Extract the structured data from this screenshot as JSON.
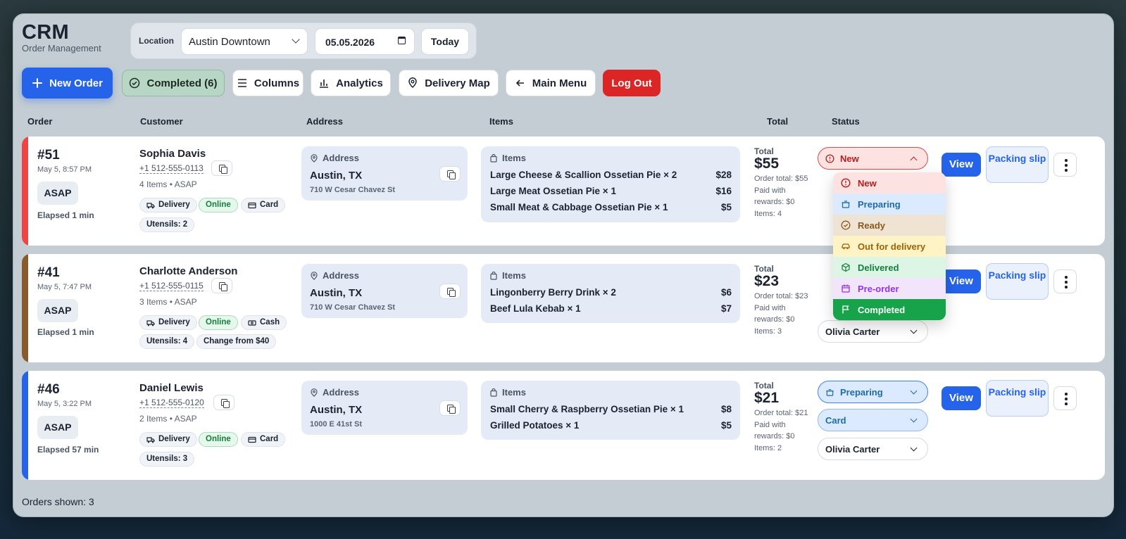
{
  "brand": {
    "title": "CRM",
    "subtitle": "Order Management"
  },
  "filters": {
    "location_label": "Location",
    "location_value": "Austin Downtown",
    "date_value": "05.05.2026",
    "today_label": "Today"
  },
  "toolbar": {
    "new_order": "New Order",
    "completed": "Completed (6)",
    "columns": "Columns",
    "analytics": "Analytics",
    "delivery_map": "Delivery Map",
    "main_menu": "Main Menu",
    "logout": "Log Out"
  },
  "columns": {
    "order": "Order",
    "customer": "Customer",
    "address": "Address",
    "items": "Items",
    "total": "Total",
    "status": "Status"
  },
  "orders": [
    {
      "number": "#51",
      "date": "May 5, 8:57 PM",
      "asap": "ASAP",
      "elapsed": "Elapsed 1 min",
      "customer": "Sophia Davis",
      "phone": "+1 512-555-0113",
      "items_count": "4 Items",
      "timing": "ASAP",
      "chips": [
        "Delivery",
        "Online",
        "Card",
        "Utensils: 2"
      ],
      "address_label": "Address",
      "city": "Austin, TX",
      "street": "710 W Cesar Chavez St",
      "items_label": "Items",
      "items": [
        {
          "name": "Large Cheese & Scallion Ossetian Pie × 2",
          "price": "$28"
        },
        {
          "name": "Large Meat Ossetian Pie × 1",
          "price": "$16"
        },
        {
          "name": "Small Meat & Cabbage Ossetian Pie × 1",
          "price": "$5"
        }
      ],
      "total_label": "Total",
      "total": "$55",
      "order_total": "Order total: $55",
      "paid_rewards": "Paid with rewards: $0",
      "items_summary": "Items: 4",
      "status": "New",
      "accent": "#ef4444"
    },
    {
      "number": "#41",
      "date": "May 5, 7:47 PM",
      "asap": "ASAP",
      "elapsed": "Elapsed 1 min",
      "customer": "Charlotte Anderson",
      "phone": "+1 512-555-0115",
      "items_count": "3 Items",
      "timing": "ASAP",
      "chips": [
        "Delivery",
        "Online",
        "Cash",
        "Utensils: 4",
        "Change from $40"
      ],
      "address_label": "Address",
      "city": "Austin, TX",
      "street": "710 W Cesar Chavez St",
      "items_label": "Items",
      "items": [
        {
          "name": "Lingonberry Berry Drink × 2",
          "price": "$6"
        },
        {
          "name": "Beef Lula Kebab × 1",
          "price": "$7"
        }
      ],
      "total_label": "Total",
      "total": "$23",
      "order_total": "Order total: $23",
      "paid_rewards": "Paid with rewards: $0",
      "items_summary": "Items: 3",
      "courier": "Olivia Carter",
      "accent": "#8b5a2b"
    },
    {
      "number": "#46",
      "date": "May 5, 3:22 PM",
      "asap": "ASAP",
      "elapsed": "Elapsed 57 min",
      "customer": "Daniel Lewis",
      "phone": "+1 512-555-0120",
      "items_count": "2 Items",
      "timing": "ASAP",
      "chips": [
        "Delivery",
        "Online",
        "Card",
        "Utensils: 3"
      ],
      "address_label": "Address",
      "city": "Austin, TX",
      "street": "1000 E 41st St",
      "items_label": "Items",
      "items": [
        {
          "name": "Small Cherry & Raspberry Ossetian Pie × 1",
          "price": "$8"
        },
        {
          "name": "Grilled Potatoes × 1",
          "price": "$5"
        }
      ],
      "total_label": "Total",
      "total": "$21",
      "order_total": "Order total: $21",
      "paid_rewards": "Paid with rewards: $0",
      "items_summary": "Items: 2",
      "status": "Preparing",
      "payment": "Card",
      "courier": "Olivia Carter",
      "accent": "#2563eb"
    }
  ],
  "actions": {
    "view": "View",
    "packing_slip": "Packing slip"
  },
  "status_menu": [
    {
      "label": "New",
      "icon": "clock-icon",
      "bg": "#fde2e2",
      "fg": "#b91c1c"
    },
    {
      "label": "Preparing",
      "icon": "pot-icon",
      "bg": "#dbeafe",
      "fg": "#1e6ba8"
    },
    {
      "label": "Ready",
      "icon": "check-circle-icon",
      "bg": "#efe3d3",
      "fg": "#8a5a1a"
    },
    {
      "label": "Out for delivery",
      "icon": "car-icon",
      "bg": "#fdf3c4",
      "fg": "#a16207"
    },
    {
      "label": "Delivered",
      "icon": "box-icon",
      "bg": "#dcf5e4",
      "fg": "#15803d"
    },
    {
      "label": "Pre-order",
      "icon": "calendar-icon",
      "bg": "#f1e4fb",
      "fg": "#9333ea"
    },
    {
      "label": "Completed",
      "icon": "flag-icon",
      "bg": "#16a34a",
      "fg": "#ffffff"
    }
  ],
  "footer": {
    "orders_shown": "Orders shown: 3"
  }
}
